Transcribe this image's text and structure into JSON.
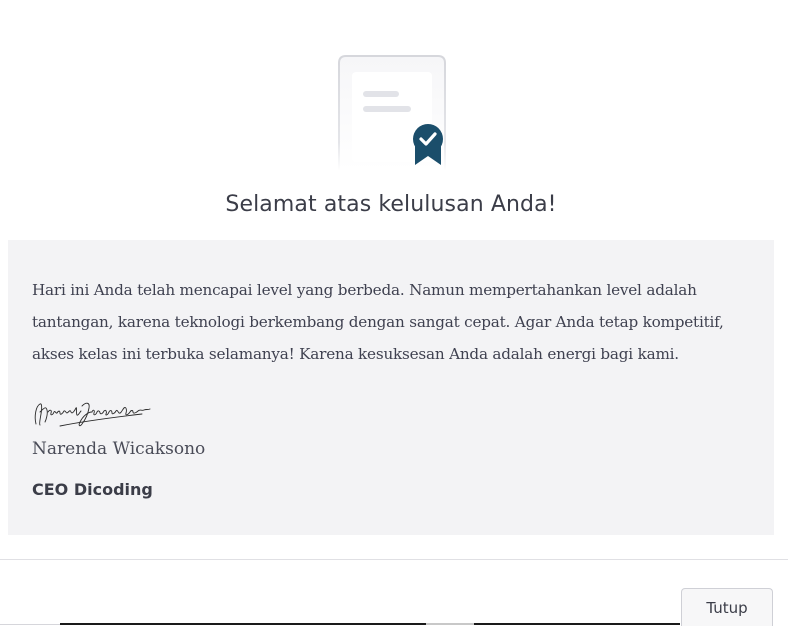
{
  "modal": {
    "title": "Selamat atas kelulusan Anda!",
    "message": "Hari ini Anda telah mencapai level yang berbeda. Namun mempertahankan level adalah tantangan, karena teknologi berkembang dengan sangat cepat. Agar Anda tetap kompetitif, akses kelas ini terbuka selamanya! Karena kesuksesan Anda adalah energi bagi kami.",
    "signer_name": "Narenda Wicaksono",
    "signer_role": "CEO Dicoding",
    "close_label": "Tutup"
  },
  "icons": {
    "illustration": "certificate-badge-icon",
    "signature": "handwritten-signature"
  },
  "colors": {
    "badge": "#1b4e6b",
    "card_background": "#f3f3f5"
  }
}
